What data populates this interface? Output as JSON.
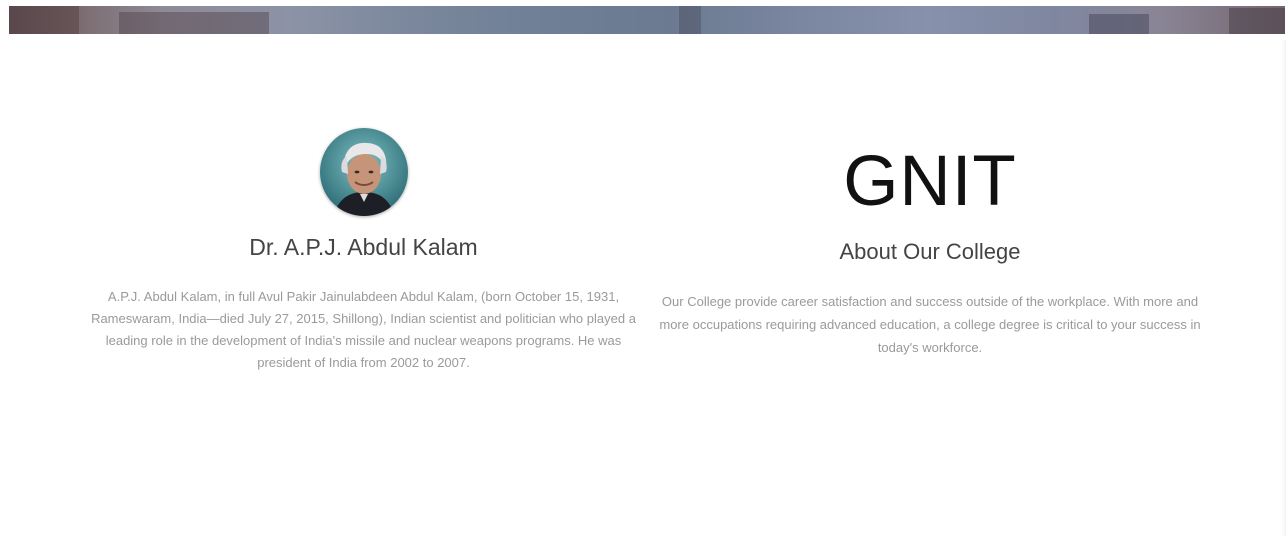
{
  "profile": {
    "name": "Dr. A.P.J. Abdul Kalam",
    "bio": "A.P.J. Abdul Kalam, in full Avul Pakir Jainulabdeen Abdul Kalam, (born October 15, 1931, Rameswaram, India—died July 27, 2015, Shillong), Indian scientist and politician who played a leading role in the development of India's missile and nuclear weapons programs. He was president of India from 2002 to 2007."
  },
  "college": {
    "logo_text": "GNIT",
    "heading": "About Our College",
    "description": "Our College provide career satisfaction and success outside of the workplace. With more and more occupations requiring advanced education, a college degree is critical to your success in today's workforce."
  },
  "colors": {
    "heading_text": "#444444",
    "body_text": "#9a9a9a",
    "logo_text": "#111111",
    "background": "#ffffff"
  }
}
